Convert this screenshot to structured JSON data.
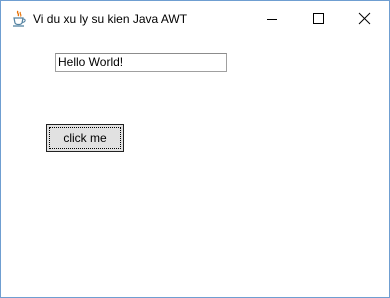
{
  "window": {
    "title": "Vi du xu ly su kien Java AWT",
    "icon": "java-cup-icon",
    "controls": {
      "minimize": "minimize-icon",
      "maximize": "maximize-icon",
      "close": "close-icon"
    }
  },
  "form": {
    "text_field_value": "Hello World!",
    "button_label": "click me"
  },
  "colors": {
    "window_border": "#6f9ed1",
    "client_background": "#ffffff",
    "button_background": "#e1e1e1"
  }
}
